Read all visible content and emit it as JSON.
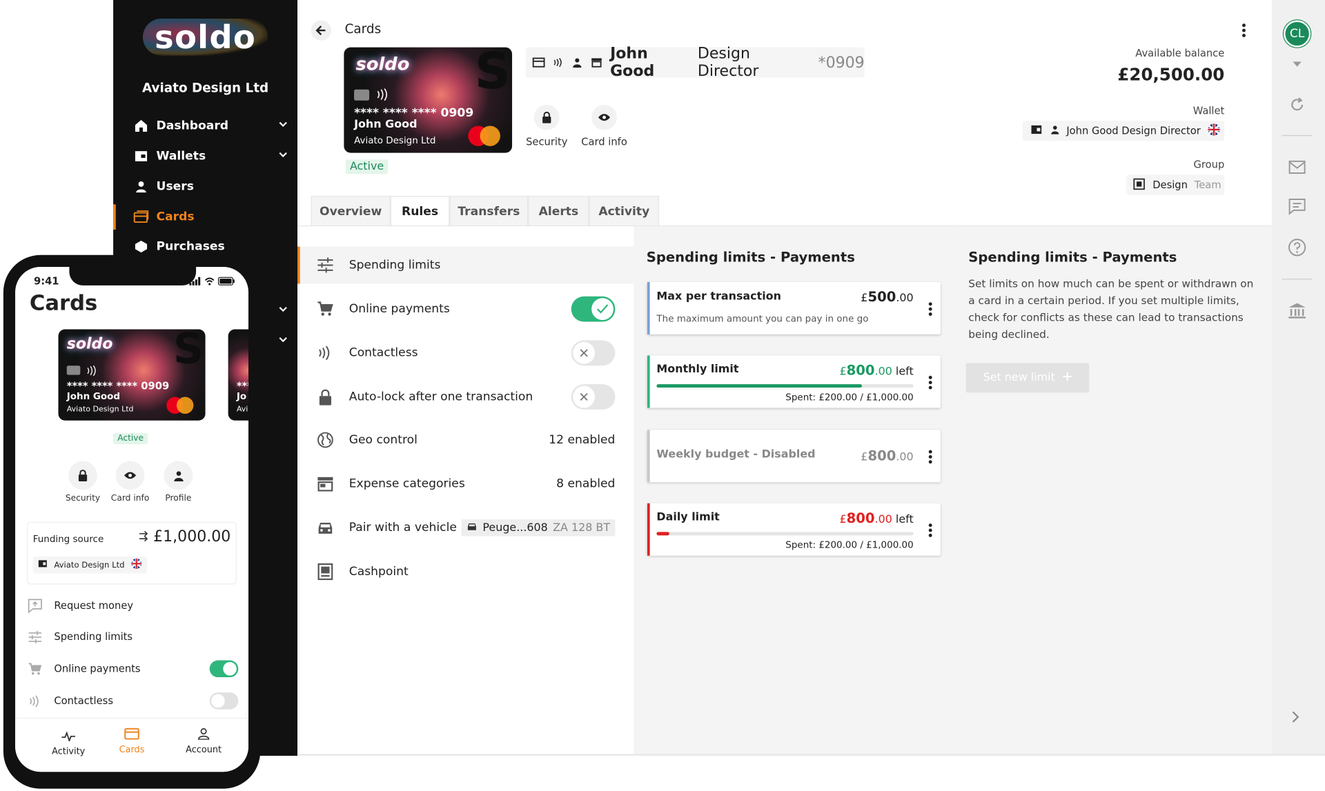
{
  "sidebar": {
    "logo": "soldo",
    "company": "Aviato Design Ltd",
    "items": [
      {
        "label": "Dashboard"
      },
      {
        "label": "Wallets"
      },
      {
        "label": "Users"
      },
      {
        "label": "Cards"
      },
      {
        "label": "Purchases"
      }
    ]
  },
  "header": {
    "breadcrumb": "Cards",
    "card": {
      "logo": "soldo",
      "number": "**** **** **** 0909",
      "holder": "John Good",
      "company": "Aviato Design Ltd",
      "status": "Active"
    },
    "user_name": "John Good",
    "user_role": "Design Director",
    "card_suffix": "*0909",
    "actions": [
      {
        "label": "Security"
      },
      {
        "label": "Card info"
      }
    ],
    "balance_label": "Available balance",
    "balance": "£20,500.00",
    "wallet_label": "Wallet",
    "wallet_value": "John Good Design Director",
    "group_label": "Group",
    "group_name": "Design",
    "group_type": "Team"
  },
  "tabs": [
    {
      "label": "Overview"
    },
    {
      "label": "Rules"
    },
    {
      "label": "Transfers"
    },
    {
      "label": "Alerts"
    },
    {
      "label": "Activity"
    }
  ],
  "rules": {
    "spending_limits": "Spending limits",
    "online_payments": "Online payments",
    "online_payments_on": true,
    "contactless": "Contactless",
    "contactless_on": false,
    "autolock": "Auto-lock after one transaction",
    "autolock_on": false,
    "geo": "Geo control",
    "geo_value": "12 enabled",
    "expense": "Expense categories",
    "expense_value": "8 enabled",
    "vehicle": "Pair with a vehicle",
    "vehicle_model": "Peuge...608",
    "vehicle_plate": "ZA 128 BT",
    "cashpoint": "Cashpoint"
  },
  "limits": {
    "title": "Spending limits - Payments",
    "max": {
      "title": "Max per transaction",
      "currency": "£",
      "amount": "500",
      "decimals": ".00",
      "desc": "The maximum amount you can pay in one go"
    },
    "monthly": {
      "title": "Monthly limit",
      "currency": "£",
      "amount": "800",
      "decimals": ".00",
      "suffix": " left",
      "spent": "Spent: £200.00 / £1,000.00",
      "progress": 0.8,
      "color": "#1b9a63"
    },
    "weekly": {
      "title": "Weekly budget - Disabled",
      "currency": "£",
      "amount": "800",
      "decimals": ".00"
    },
    "daily": {
      "title": "Daily limit",
      "currency": "£",
      "amount": "800",
      "decimals": ".00",
      "suffix": " left",
      "spent": "Spent: £200.00 / £1,000.00",
      "progress": 0.05,
      "color": "#e02020"
    }
  },
  "info": {
    "title": "Spending limits - Payments",
    "body": "Set limits on how much can be spent or withdrawn on a card in a certain period. If you set multiple limits, check for conflicts as these can lead to transactions being declined.",
    "button": "Set new limit"
  },
  "rail": {
    "avatar": "CL"
  },
  "phone": {
    "time": "9:41",
    "title": "Cards",
    "card": {
      "logo": "soldo",
      "number": "**** **** **** 0909",
      "holder": "John Good",
      "company": "Aviato Design Ltd",
      "status": "Active"
    },
    "card2": {
      "number": "***",
      "holder": "Jo",
      "company": "Avi"
    },
    "actions": [
      {
        "label": "Security"
      },
      {
        "label": "Card info"
      },
      {
        "label": "Profile"
      }
    ],
    "funding_label": "Funding source",
    "funding_amount": "£1,000.00",
    "funding_company": "Aviato Design Ltd",
    "rows": [
      {
        "label": "Request money"
      },
      {
        "label": "Spending limits"
      },
      {
        "label": "Online payments"
      },
      {
        "label": "Contactless"
      }
    ],
    "online_payments_on": true,
    "contactless_on": false,
    "bottom_nav": [
      {
        "label": "Activity"
      },
      {
        "label": "Cards"
      },
      {
        "label": "Account"
      }
    ]
  },
  "colors": {
    "accent": "#f0831e",
    "green": "#1b8a5a",
    "red": "#e02020"
  }
}
